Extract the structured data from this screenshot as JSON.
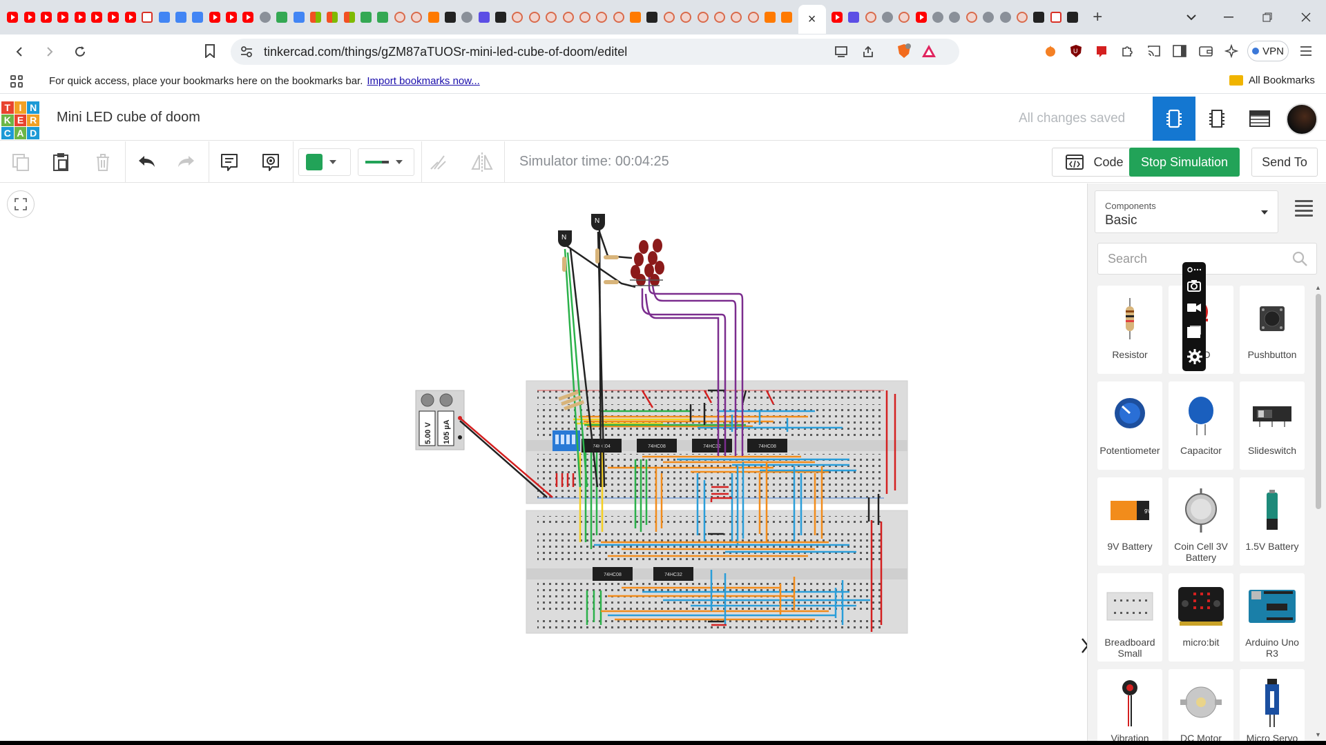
{
  "browser": {
    "url": "tinkercad.com/things/gZM87aTUOSr-mini-led-cube-of-doom/editel",
    "bookmarks_hint": "For quick access, place your bookmarks here on the bookmarks bar.",
    "bookmarks_link": "Import bookmarks now...",
    "all_bookmarks": "All Bookmarks",
    "vpn_label": "VPN",
    "close_tab_glyph": "×",
    "new_tab_glyph": "+"
  },
  "app": {
    "logo_letters": [
      "T",
      "I",
      "N",
      "K",
      "E",
      "R",
      "C",
      "A",
      "D"
    ],
    "logo_colors": [
      "#e8442f",
      "#f2a024",
      "#1c9ad6",
      "#6cb646",
      "#e8442f",
      "#f2a024",
      "#1c9ad6",
      "#6cb646",
      "#1c9ad6"
    ],
    "design_title": "Mini LED cube of doom",
    "save_status": "All changes saved",
    "accent": "#1477d1"
  },
  "toolbar": {
    "simulator_time": "Simulator time: 00:04:25",
    "code_label": "Code",
    "stop_label": "Stop Simulation",
    "send_label": "Send To",
    "color_swatch": "#22a358"
  },
  "panel": {
    "components_label": "Components",
    "components_value": "Basic",
    "search_placeholder": "Search",
    "components": [
      {
        "name": "Resistor",
        "icon": "resistor-icon"
      },
      {
        "name": "LED",
        "icon": "led-icon"
      },
      {
        "name": "Pushbutton",
        "icon": "pushbutton-icon"
      },
      {
        "name": "Potentiometer",
        "icon": "potentiometer-icon"
      },
      {
        "name": "Capacitor",
        "icon": "capacitor-icon"
      },
      {
        "name": "Slideswitch",
        "icon": "slideswitch-icon"
      },
      {
        "name": "9V Battery",
        "icon": "9v-battery-icon"
      },
      {
        "name": "Coin Cell 3V Battery",
        "icon": "coin-cell-icon"
      },
      {
        "name": "1.5V Battery",
        "icon": "aa-battery-icon"
      },
      {
        "name": "Breadboard Small",
        "icon": "breadboard-icon"
      },
      {
        "name": "micro:bit",
        "icon": "microbit-icon"
      },
      {
        "name": "Arduino Uno R3",
        "icon": "arduino-icon"
      },
      {
        "name": "Vibration",
        "icon": "vibration-motor-icon"
      },
      {
        "name": "DC Motor",
        "icon": "dc-motor-icon"
      },
      {
        "name": "Micro Servo",
        "icon": "micro-servo-icon"
      }
    ]
  },
  "circuit": {
    "meter_voltage": "5.00 V",
    "meter_current": "105 µA",
    "chips_top": [
      "74HC04",
      "74HC08",
      "74HC32",
      "74HC08"
    ],
    "chips_bottom": [
      "74HC08",
      "74HC32"
    ],
    "transistor_label": "N"
  }
}
